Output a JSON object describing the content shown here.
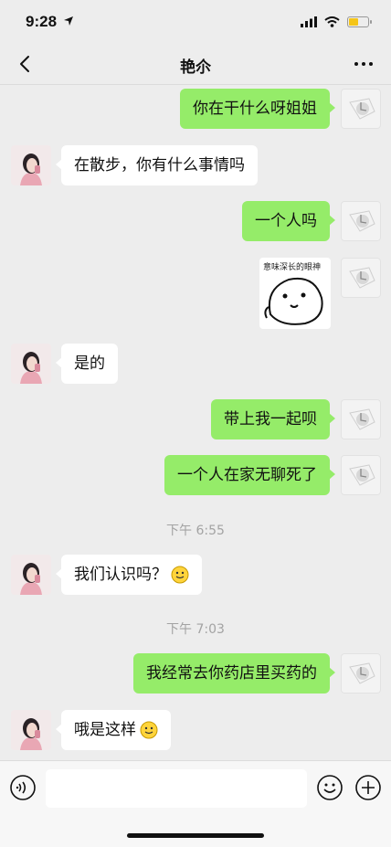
{
  "status": {
    "time": "9:28",
    "battery_level": 0.55,
    "battery_color": "#f5c518"
  },
  "header": {
    "title": "艳尒"
  },
  "messages": [
    {
      "side": "out",
      "text": "你在干什么呀姐姐"
    },
    {
      "side": "in",
      "text": "在散步，你有什么事情吗"
    },
    {
      "side": "out",
      "text": "一个人吗"
    },
    {
      "side": "out",
      "type": "sticker",
      "caption": "意味深长的眼神"
    },
    {
      "side": "in",
      "text": "是的"
    },
    {
      "side": "out",
      "text": "带上我一起呗"
    },
    {
      "side": "out",
      "text": "一个人在家无聊死了"
    },
    {
      "type": "time",
      "text": "下午 6:55"
    },
    {
      "side": "in",
      "text": "我们认识吗？",
      "emoji": "smile-emoji"
    },
    {
      "type": "time",
      "text": "下午 7:03"
    },
    {
      "side": "out",
      "text": "我经常去你药店里买药的"
    },
    {
      "side": "in",
      "text": "哦是这样",
      "emoji": "smile-emoji"
    }
  ],
  "input": {
    "placeholder": ""
  },
  "colors": {
    "outgoing_bubble": "#95ec69",
    "incoming_bubble": "#ffffff",
    "background": "#ededed"
  }
}
